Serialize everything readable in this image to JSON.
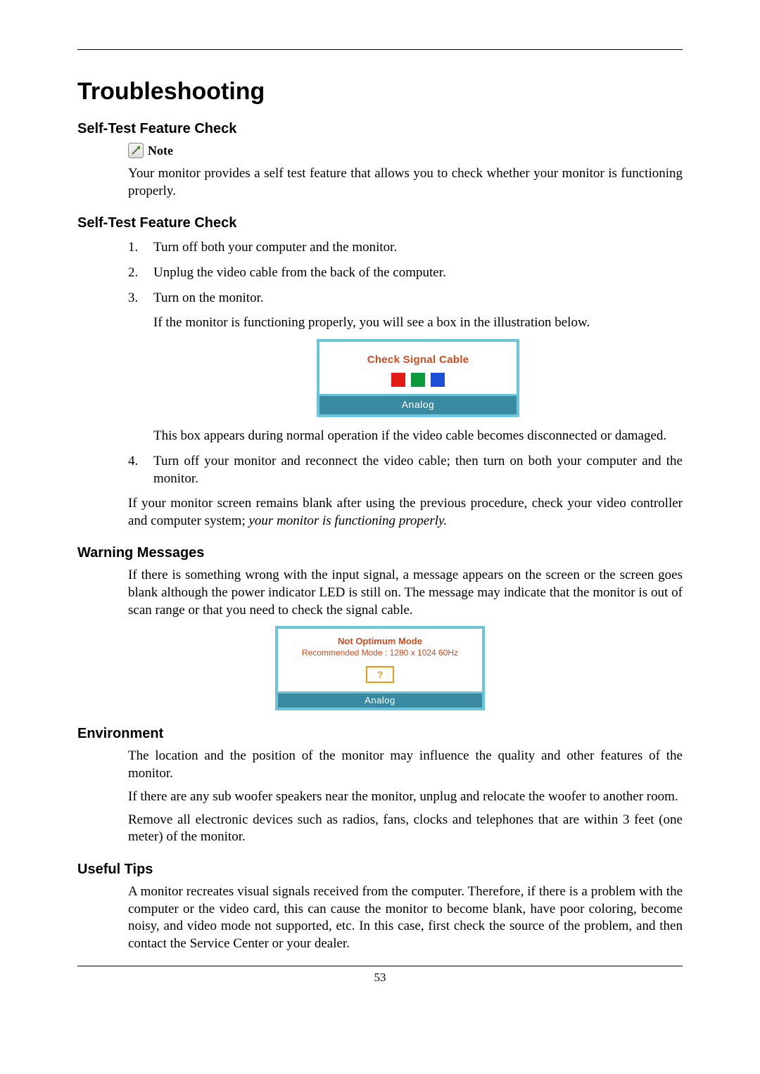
{
  "page_number": "53",
  "title": "Troubleshooting",
  "sec1": {
    "heading": "Self-Test Feature Check",
    "note_label": "Note",
    "note_para": "Your monitor provides a self test feature that allows you to check whether your monitor is functioning properly."
  },
  "sec2": {
    "heading": "Self-Test Feature Check",
    "step1": "Turn off both your computer and the monitor.",
    "step2": "Unplug the video cable from the back of the computer.",
    "step3": "Turn on the monitor.",
    "step3_sub": "If the monitor is functioning properly, you will see a box in the illustration below.",
    "step3_after": "This box appears during normal operation if the video cable becomes disconnected or damaged.",
    "step4": "Turn off your monitor and reconnect the video cable; then turn on both your computer and the monitor.",
    "tail_plain": "If your monitor screen remains blank after using the previous procedure, check your video controller and computer system; ",
    "tail_italic": "your monitor is functioning properly."
  },
  "osd1": {
    "title": "Check Signal Cable",
    "footer": "Analog"
  },
  "sec3": {
    "heading": "Warning Messages",
    "para": "If there is something wrong with the input signal, a message appears on the screen or the screen goes blank although the power indicator LED is still on. The message may indicate that the monitor is out of scan range or that you need to check the signal cable."
  },
  "osd2": {
    "line1": "Not Optimum Mode",
    "line2": "Recommended Mode : 1280 x 1024  60Hz",
    "btn": "?",
    "footer": "Analog"
  },
  "sec4": {
    "heading": "Environment",
    "p1": "The location and the position of the monitor may influence the quality and other features of the monitor.",
    "p2": "If there are any sub woofer speakers near the monitor, unplug and relocate the woofer to another room.",
    "p3": "Remove all electronic devices such as radios, fans, clocks and telephones that are within 3 feet (one meter) of the monitor."
  },
  "sec5": {
    "heading": "Useful Tips",
    "p1": "A monitor recreates visual signals received from the computer. Therefore, if there is a problem with the computer or the video card, this can cause the monitor to become blank, have poor coloring, become noisy, and video mode not supported, etc. In this case, first check the source of the problem, and then contact the Service Center or your dealer."
  }
}
